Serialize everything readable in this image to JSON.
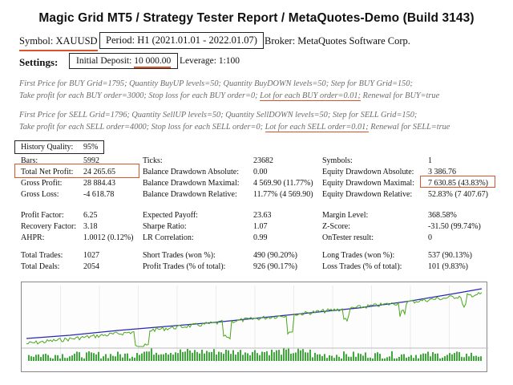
{
  "header": {
    "title": "Magic Grid MT5  /  Strategy Tester Report  /  MetaQuotes-Demo (Build 3143)"
  },
  "info": {
    "symbol": "Symbol: XAUUSD",
    "period": "Period: H1 (2021.01.01 - 2022.01.07)",
    "broker": "Broker: MetaQuotes Software Corp."
  },
  "settings": {
    "label": "Settings:",
    "deposit_label": "Initial Deposit:",
    "deposit_value": "10 000.00",
    "leverage": "Leverage:  1:100"
  },
  "buy_params": {
    "line1": "First Price for BUY Grid=1795;  Quantity BuyUP levels=50;  Quantity BuyDOWN levels=50;  Step for BUY Grid=150;",
    "line2a": "Take profit for each BUY order=3000;  Stop loss for each BUY order=0;",
    "line2b": "Lot for each BUY order=0.01;",
    "line2c": "Renewal for BUY=true"
  },
  "sell_params": {
    "line1": "First Price for SELL Grid=1796;  Quantity SellUP levels=50;  Quantity SellDOWN levels=50;  Step for SELL Grid=150;",
    "line2a": "Take profit for each SELL order=4000;  Stop loss for each SELL order=0;",
    "line2b": "Lot for each SELL order=0.01;",
    "line2c": "Renewal for SELL=true"
  },
  "stats": {
    "history_quality": {
      "label": "History Quality:",
      "value": "95%"
    },
    "col1": [
      {
        "label": "Bars:",
        "value": "5992"
      },
      {
        "label": "Total Net Profit:",
        "value": "24 265.65"
      },
      {
        "label": "Gross Profit:",
        "value": "28 884.43"
      },
      {
        "label": "Gross Loss:",
        "value": "-4 618.78"
      },
      {
        "label": "Profit Factor:",
        "value": "6.25"
      },
      {
        "label": "Recovery Factor:",
        "value": "3.18"
      },
      {
        "label": "AHPR:",
        "value": "1.0012 (0.12%)"
      },
      {
        "label": "Total Trades:",
        "value": "1027"
      },
      {
        "label": "Total Deals:",
        "value": "2054"
      }
    ],
    "col2": [
      {
        "label": "Ticks:",
        "value": "23682"
      },
      {
        "label": "Balance Drawdown Absolute:",
        "value": "0.00"
      },
      {
        "label": "Balance Drawdown Maximal:",
        "value": "4 569.90 (11.77%)"
      },
      {
        "label": "Balance Drawdown Relative:",
        "value": "11.77% (4 569.90)"
      },
      {
        "label": "Expected Payoff:",
        "value": "23.63"
      },
      {
        "label": "Sharpe Ratio:",
        "value": "1.07"
      },
      {
        "label": "LR Correlation:",
        "value": "0.99"
      },
      {
        "label": "Short Trades (won %):",
        "value": "490 (90.20%)"
      },
      {
        "label": "Profit Trades (% of total):",
        "value": "926 (90.17%)"
      }
    ],
    "col3": [
      {
        "label": "Symbols:",
        "value": "1"
      },
      {
        "label": "Equity Drawdown Absolute:",
        "value": "3 386.76"
      },
      {
        "label": "Equity Drawdown Maximal:",
        "value": "7 630.85 (43.83%)"
      },
      {
        "label": "Equity Drawdown Relative:",
        "value": "52.83% (7 407.67)"
      },
      {
        "label": "Margin Level:",
        "value": "368.58%"
      },
      {
        "label": "Z-Score:",
        "value": "-31.50 (99.74%)"
      },
      {
        "label": "OnTester result:",
        "value": "0"
      },
      {
        "label": "Long Trades (won %):",
        "value": "537 (90.13%)"
      },
      {
        "label": "Loss Trades (% of total):",
        "value": "101 (9.83%)"
      }
    ]
  },
  "colors": {
    "balance_line": "#2828b4",
    "equity_line": "#49a81a",
    "deposit_bars": "#3fa83a",
    "highlight": "#d9562b"
  }
}
